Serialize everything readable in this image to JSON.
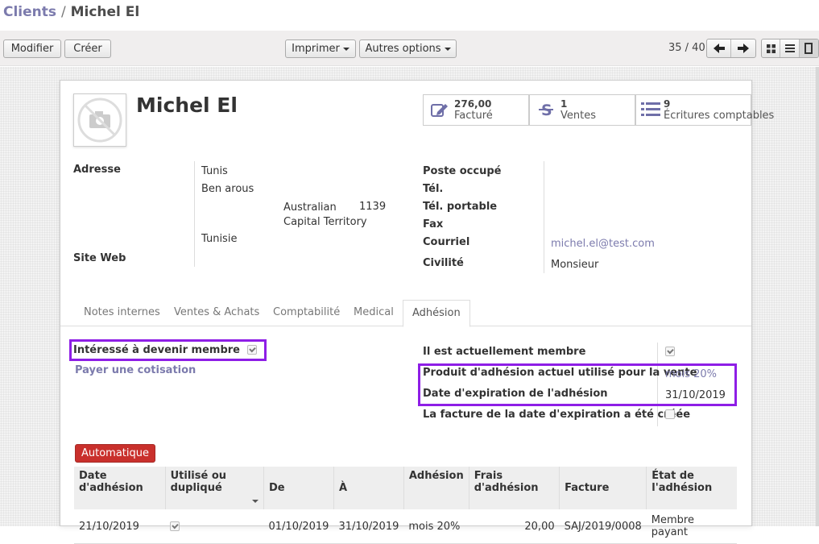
{
  "breadcrumb": {
    "parent": "Clients",
    "separator": "/",
    "current": "Michel El"
  },
  "toolbar": {
    "edit": "Modifier",
    "create": "Créer",
    "print": "Imprimer",
    "more": "Autres options",
    "pager": "35 / 40"
  },
  "partner": {
    "name": "Michel El",
    "stats": [
      {
        "value": "276,00",
        "label": "Facturé",
        "icon": "edit-icon"
      },
      {
        "value": "1",
        "label": "Ventes",
        "icon": "strikethrough-s-icon"
      },
      {
        "value": "9",
        "label": "Écritures comptables",
        "icon": "list-icon"
      }
    ]
  },
  "address": {
    "label": "Adresse",
    "city": "Tunis",
    "street": "Ben arous",
    "state_line1": "Australian",
    "state_line2": "Capital Territory",
    "zip": "1139",
    "country": "Tunisie",
    "website_label": "Site Web"
  },
  "contact": {
    "job_label": "Poste occupé",
    "phone_label": "Tél.",
    "mobile_label": "Tél. portable",
    "fax_label": "Fax",
    "email_label": "Courriel",
    "email": "michel.el@test.com",
    "title_label": "Civilité",
    "title": "Monsieur"
  },
  "tabs": [
    "Notes internes",
    "Ventes & Achats",
    "Comptabilité",
    "Medical",
    "Adhésion"
  ],
  "membership": {
    "interested_label": "Intéressé à devenir membre",
    "interested": true,
    "pay_link": "Payer une cotisation",
    "current_member_label": "Il est actuellement membre",
    "current_member": true,
    "product_label": "Produit d'adhésion actuel utilisé pour la vente",
    "product": "mois 20%",
    "expiry_label": "Date d'expiration de l'adhésion",
    "expiry": "31/10/2019",
    "invoice_created_label": "La facture de la date d'expiration a été créée",
    "invoice_created": false,
    "auto_button": "Automatique"
  },
  "table": {
    "headers": [
      "Date d'adhésion",
      "Utilisé ou dupliqué",
      "De",
      "À",
      "Adhésion",
      "Frais d'adhésion",
      "Facture",
      "État de l'adhésion"
    ],
    "rows": [
      {
        "date": "21/10/2019",
        "used": true,
        "from": "01/10/2019",
        "to": "31/10/2019",
        "membership": "mois 20%",
        "fee": "20,00",
        "invoice": "SAJ/2019/0008",
        "state": "Membre payant"
      }
    ]
  }
}
